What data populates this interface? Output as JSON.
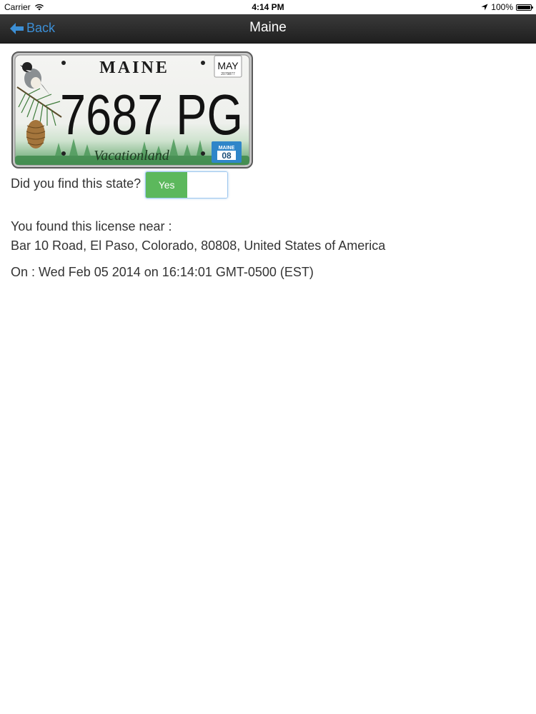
{
  "status_bar": {
    "carrier": "Carrier",
    "time": "4:14 PM",
    "battery": "100%"
  },
  "nav": {
    "back_label": "Back",
    "title": "Maine"
  },
  "plate": {
    "state": "MAINE",
    "month": "MAY",
    "sticker_serial": "2079877",
    "number": "7687 PG",
    "slogan": "Vacationland",
    "year_sticker_state": "MAINE",
    "year_sticker_year": "08"
  },
  "found": {
    "question": "Did you find this state?",
    "toggle_label": "Yes",
    "toggle_on": true
  },
  "location": {
    "label": "You found this license near :",
    "address": "Bar 10 Road, El Paso, Colorado, 80808, United States of America",
    "date": "On : Wed Feb 05 2014 on 16:14:01 GMT-0500 (EST)"
  },
  "colors": {
    "nav_bar": "#2b2b2b",
    "back_link": "#3c8fd6",
    "toggle_on": "#5cb85c",
    "plate_green": "#3e8a4c",
    "plate_blue": "#2f86c9"
  }
}
